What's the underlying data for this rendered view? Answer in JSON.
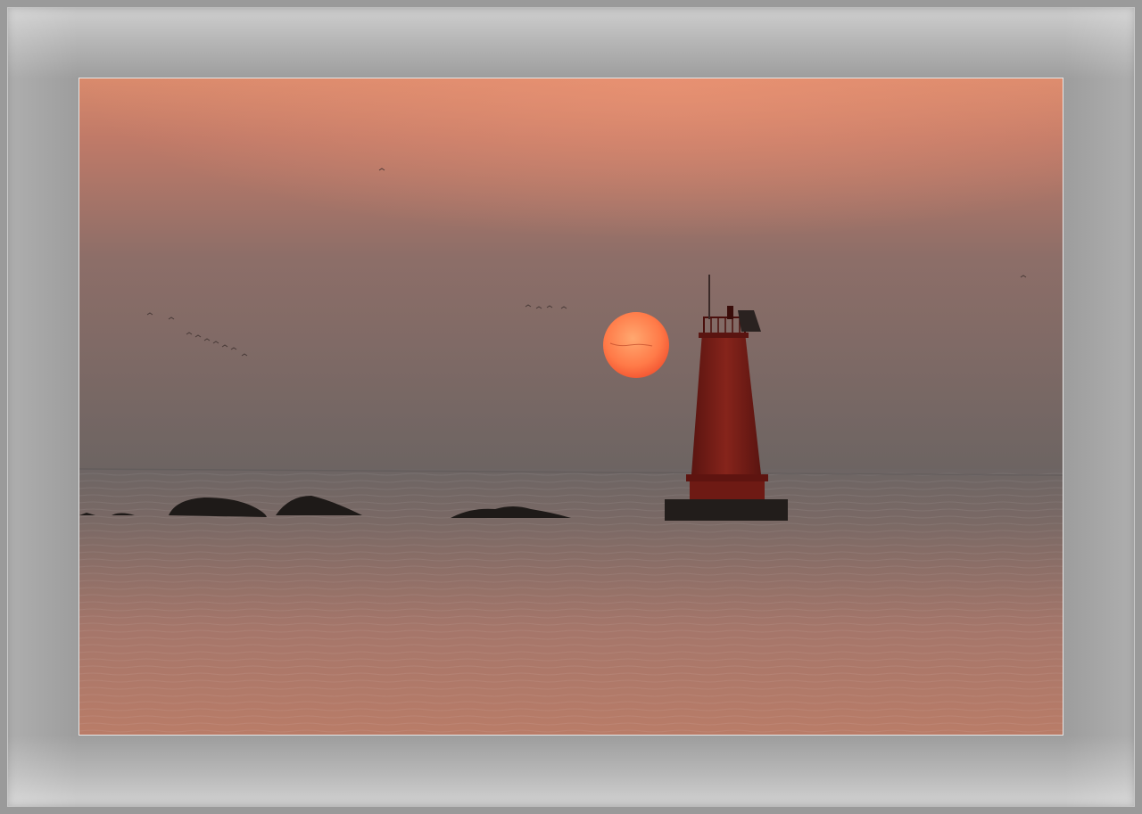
{
  "image": {
    "subject": "sunset-over-sea-with-lighthouse",
    "colors": {
      "sky_top": "#d98a6c",
      "sky_mid": "#8a6b66",
      "sky_horizon": "#6e6462",
      "sun": "#ff6a3d",
      "sun_core": "#ffa06a",
      "sea": "#7a6a66",
      "sea_glow": "#c88066",
      "lighthouse": "#7a1e17",
      "rocks": "#1c1917",
      "frame": "#9d9d9d"
    }
  }
}
